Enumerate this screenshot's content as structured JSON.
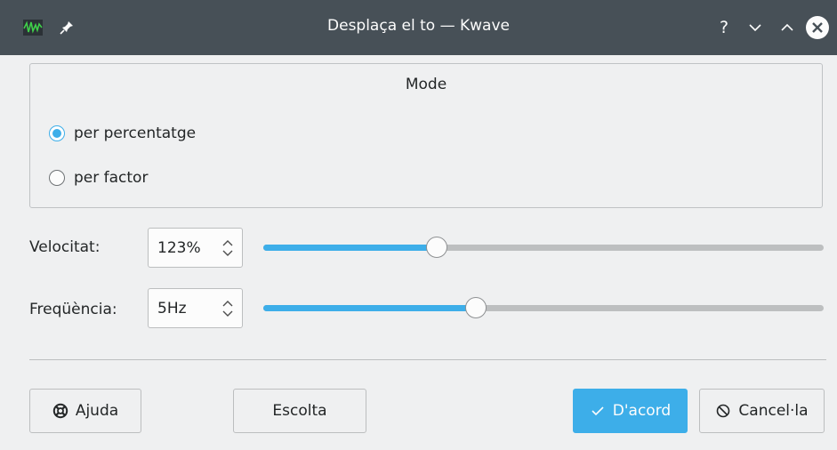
{
  "window": {
    "title": "Desplaça el to — Kwave",
    "help_label": "?"
  },
  "mode_group": {
    "title": "Mode",
    "options": [
      {
        "label": "per percentatge",
        "checked": true
      },
      {
        "label": "per factor",
        "checked": false
      }
    ]
  },
  "speed": {
    "label": "Velocitat:",
    "value": "123%",
    "slider_fraction": 0.31
  },
  "frequency": {
    "label": "Freqüència:",
    "value": "5Hz",
    "slider_fraction": 0.38
  },
  "buttons": {
    "help": "Ajuda",
    "listen": "Escolta",
    "ok": "D'acord",
    "cancel": "Cancel·la"
  },
  "colors": {
    "accent": "#3daee9",
    "titlebar": "#475057",
    "window_bg": "#eff0f1"
  },
  "icons": {
    "app": "kwave-waveform-icon",
    "pin": "pin-icon",
    "minimize": "chevron-down-icon",
    "maximize": "chevron-up-icon",
    "close": "close-icon",
    "help_button": "lifebuoy-icon",
    "ok_button": "check-icon",
    "cancel_button": "cancel-icon"
  }
}
